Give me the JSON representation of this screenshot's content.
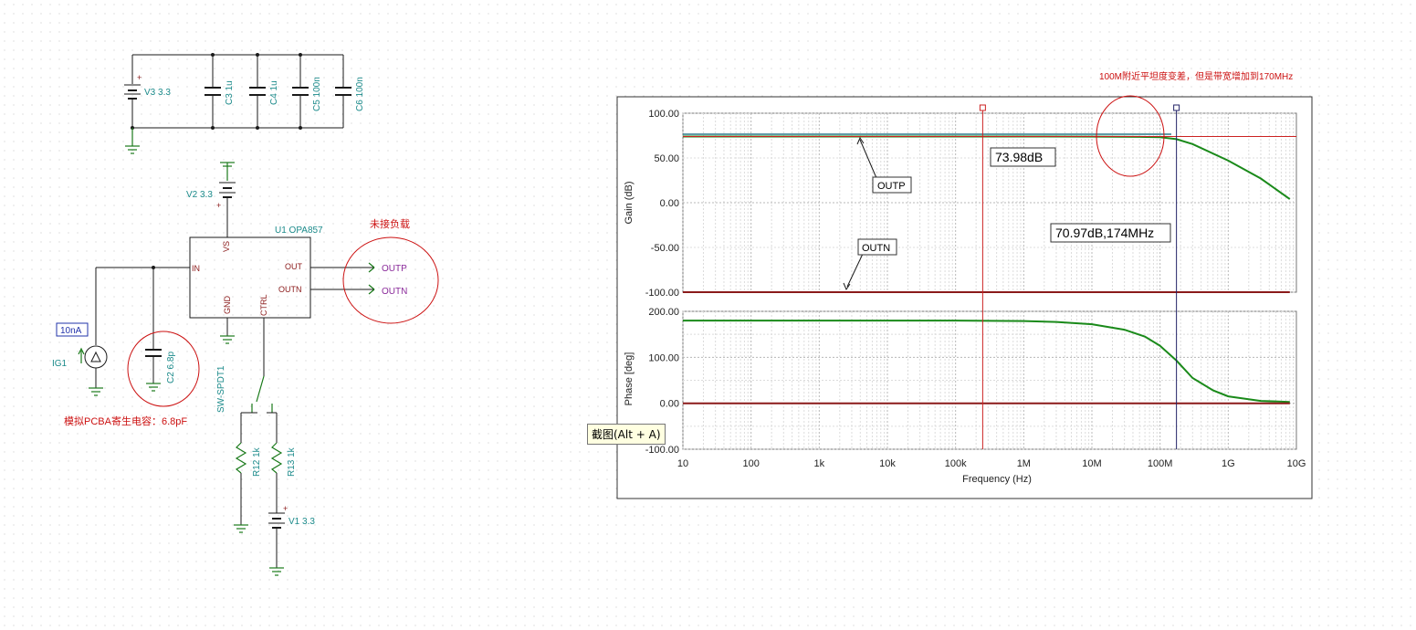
{
  "schematic": {
    "components": {
      "v3": "V3 3.3",
      "c3": "C3 1u",
      "c4": "C4 1u",
      "c5": "C5 100n",
      "c6": "C6 100n",
      "v2": "V2 3.3",
      "u1": "U1 OPA857",
      "ig1": "IG1",
      "ig1_value": "10nA",
      "c2": "C2 6.8p",
      "sw": "SW-SPDT1",
      "r12": "R12 1k",
      "r13": "R13 1k",
      "v1": "V1 3.3"
    },
    "pins": {
      "vs": "VS",
      "in": "IN",
      "out": "OUT",
      "outn": "OUTN",
      "gnd": "GND",
      "ctrl": "CTRL"
    },
    "probes": {
      "outp": "OUTP",
      "outn": "OUTN"
    },
    "plus_sign": "+",
    "notes": {
      "no_load": "未接负载",
      "pcb_cap": "模拟PCBA寄生电容：6.8pF"
    }
  },
  "plot": {
    "note": "100M附近平坦度变差，但是带宽增加到170MHz",
    "gain_axis_label": "Gain (dB)",
    "phase_axis_label": "Phase [deg]",
    "x_axis_label": "Frequency (Hz)",
    "x_ticks": [
      "10",
      "100",
      "1k",
      "10k",
      "100k",
      "1M",
      "10M",
      "100M",
      "1G",
      "10G"
    ],
    "gain_ticks": [
      "100.00",
      "50.00",
      "0.00",
      "-50.00",
      "-100.00"
    ],
    "phase_ticks": [
      "200.00",
      "100.00",
      "0.00",
      "-100.00"
    ],
    "cursor_a_label": "73.98dB",
    "cursor_b_label": "70.97dB,174MHz",
    "trace_outp": "OUTP",
    "trace_outn": "OUTN",
    "colors": {
      "outp": "#1a8a1a",
      "outn": "#8b1a1a",
      "cursor_a": "#cc2222",
      "cursor_b": "#222266"
    }
  },
  "chart_data": {
    "type": "line",
    "x_scale": "log",
    "xlim": [
      10,
      10000000000
    ],
    "panels": [
      {
        "ylabel": "Gain (dB)",
        "ylim": [
          -100,
          100
        ],
        "series": [
          {
            "name": "OUTP",
            "x": [
              10,
              1000000,
              10000000,
              50000000,
              100000000,
              174000000,
              300000000,
              1000000000,
              3000000000,
              8000000000
            ],
            "y": [
              73.98,
              73.98,
              73.9,
              73.6,
              73.2,
              70.97,
              65.5,
              47,
              27,
              4
            ]
          },
          {
            "name": "OUTN",
            "x": [
              10,
              8000000000
            ],
            "y": [
              -100,
              -100
            ]
          }
        ]
      },
      {
        "ylabel": "Phase [deg]",
        "ylim": [
          -100,
          200
        ],
        "series": [
          {
            "name": "OUTP",
            "x": [
              10,
              100000,
              1000000,
              3000000,
              10000000,
              30000000,
              60000000,
              100000000,
              174000000,
              300000000,
              600000000,
              1000000000,
              3000000000,
              8000000000
            ],
            "y": [
              180,
              180,
              179,
              177,
              172,
              160,
              145,
              125,
              93,
              55,
              28,
              15,
              5,
              3
            ]
          },
          {
            "name": "OUTN",
            "x": [
              10,
              8000000000
            ],
            "y": [
              0,
              0
            ]
          }
        ]
      }
    ],
    "cursors": [
      {
        "x": 250000,
        "label": "73.98dB"
      },
      {
        "x": 174000000,
        "label": "70.97dB,174MHz"
      }
    ]
  },
  "tooltip": "截图(Alt + A)"
}
